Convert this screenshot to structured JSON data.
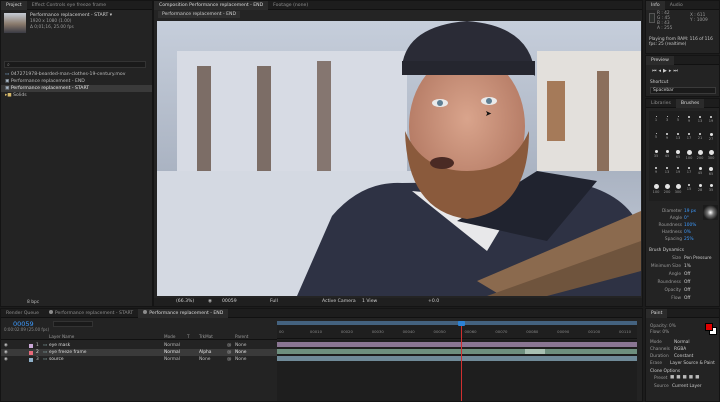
{
  "project_panel": {
    "tab_project": "Project",
    "tab_effect": "Effect Controls eye freeze frame",
    "comp_name": "Performance replacement - START ▾",
    "comp_size": "1920 x 1080 (1.00)",
    "comp_duration": "Δ 0;01;16, 25.00 fps",
    "search_placeholder": "",
    "items": [
      "047271978-bearded-man-clothes-19-century.mov",
      "Performance replacement - END",
      "Performance replacement - START",
      "Solids"
    ],
    "bpc": "8 bpc"
  },
  "composition_panel": {
    "tab_comp": "Composition Performance replacement - END",
    "tab_footage": "Footage (none)",
    "comp_label": "Performance replacement - END",
    "zoom": "(66.3%)",
    "timecode": "00059",
    "resolution": "Full",
    "camera": "Active Camera",
    "view": "1 View",
    "exposure": "+0.0"
  },
  "info_panel": {
    "tab_info": "Info",
    "tab_audio": "Audio",
    "r": "R : 42",
    "g": "G : 45",
    "b": "B : 43",
    "a": "A : 255",
    "x": "X : 611",
    "y": "Y : 1009",
    "playing": "Playing from RAM: 116 of 116",
    "fps": "fps: 25 (realtime)"
  },
  "preview_panel": {
    "title": "Preview",
    "shortcut_label": "Shortcut",
    "shortcut_value": "Spacebar"
  },
  "libraries_panel": {
    "tab_libraries": "Libraries",
    "tab_brushes": "Brushes",
    "brush_sizes": [
      "1",
      "3",
      "5",
      "9",
      "13",
      "19",
      "5",
      "9",
      "13",
      "17",
      "21",
      "27",
      "35",
      "45",
      "65",
      "100",
      "200",
      "300",
      "9",
      "13",
      "19",
      "17",
      "45",
      "65",
      "100",
      "200",
      "300",
      "15",
      "28",
      "35"
    ],
    "params": [
      {
        "label": "Diameter",
        "value": "19 px"
      },
      {
        "label": "Angle",
        "value": "0°"
      },
      {
        "label": "Roundness",
        "value": "100%"
      },
      {
        "label": "Hardness",
        "value": "0%"
      },
      {
        "label": "Spacing",
        "value": "25%"
      }
    ],
    "dynamics_title": "Brush Dynamics",
    "dynamics": [
      {
        "label": "Size",
        "value": "Pen Pressure"
      },
      {
        "label": "Minimum Size",
        "value": "1%"
      },
      {
        "label": "Angle",
        "value": "Off"
      },
      {
        "label": "Roundness",
        "value": "Off"
      },
      {
        "label": "Opacity",
        "value": "Off"
      },
      {
        "label": "Flow",
        "value": "Off"
      }
    ]
  },
  "paint_panel": {
    "title": "Paint",
    "opacity": "Opacity: 0%",
    "flow": "Flow: 0%",
    "mode_label": "Mode",
    "mode_value": "Normal",
    "channels_label": "Channels",
    "channels_value": "RGBA",
    "duration_label": "Duration",
    "duration_value": "Constant",
    "erase_label": "Erase",
    "erase_value": "Layer Source & Paint",
    "clone_title": "Clone Options",
    "preset_label": "Preset",
    "source_label": "Source",
    "source_value": "Current Layer",
    "foreground_color": "#e00000",
    "background_color": "#ffffff"
  },
  "timeline": {
    "tab_render": "Render Queue",
    "tab_start": "Performance replacement - START",
    "tab_end": "Performance replacement - END",
    "timecode": "00059",
    "timecode_sub": "0:00:02:09 (25.00 fps)",
    "col_layer": "Layer Name",
    "col_mode": "Mode",
    "col_t": "T",
    "col_trkmat": "TrkMat",
    "col_parent": "Parent",
    "layers": [
      {
        "num": "1",
        "name": "eye mask",
        "mode": "Normal",
        "trkmat": "",
        "parent": "None",
        "color": "#c9a7d6"
      },
      {
        "num": "2",
        "name": "eye freeze frame",
        "mode": "Normal",
        "trkmat": "Alpha",
        "parent": "None",
        "color": "#e86a7a"
      },
      {
        "num": "3",
        "name": "source",
        "mode": "Normal",
        "trkmat": "None",
        "parent": "None",
        "color": "#8fb0c8"
      }
    ],
    "ruler_ticks": [
      "00",
      "00010",
      "00020",
      "00030",
      "00040",
      "00050",
      "00060",
      "00070",
      "00080",
      "00090",
      "00100",
      "00110"
    ],
    "playhead_fraction": 0.5
  }
}
